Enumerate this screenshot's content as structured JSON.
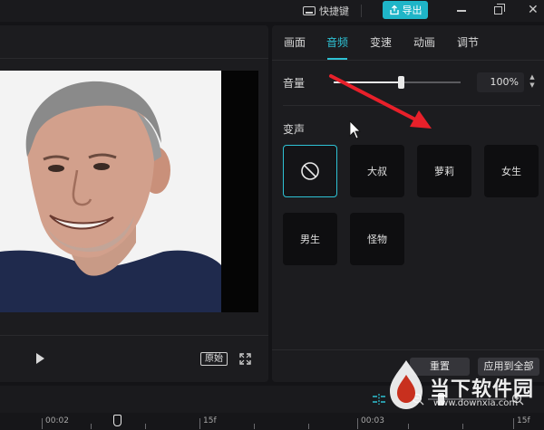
{
  "topbar": {
    "shortcut_label": "快捷键",
    "export_label": "导出"
  },
  "player": {
    "original_label": "原始"
  },
  "panel": {
    "tabs": [
      {
        "label": "画面"
      },
      {
        "label": "音频"
      },
      {
        "label": "变速"
      },
      {
        "label": "动画"
      },
      {
        "label": "调节"
      }
    ],
    "active_tab": "音频",
    "volume": {
      "label": "音量",
      "value_text": "100%",
      "level_fraction": 0.53
    },
    "voice_change": {
      "label": "变声",
      "selected": "none",
      "options": [
        {
          "label": "大叔"
        },
        {
          "label": "萝莉"
        },
        {
          "label": "女生"
        },
        {
          "label": "男生"
        },
        {
          "label": "怪物"
        }
      ]
    },
    "reset_label": "重置",
    "apply_all_label": "应用到全部"
  },
  "timeline": {
    "ruler_labels": [
      "00:02",
      "15f",
      "00:03",
      "15f"
    ],
    "zoom_fraction": 0.16
  },
  "watermark": {
    "title": "当下软件园",
    "url": "www.downxia.com"
  },
  "colors": {
    "accent": "#2ec2d4",
    "export_bg": "#1fb5c8",
    "annotation_arrow": "#e8202a",
    "panel_bg": "#1c1c1f",
    "app_bg": "#141417"
  }
}
